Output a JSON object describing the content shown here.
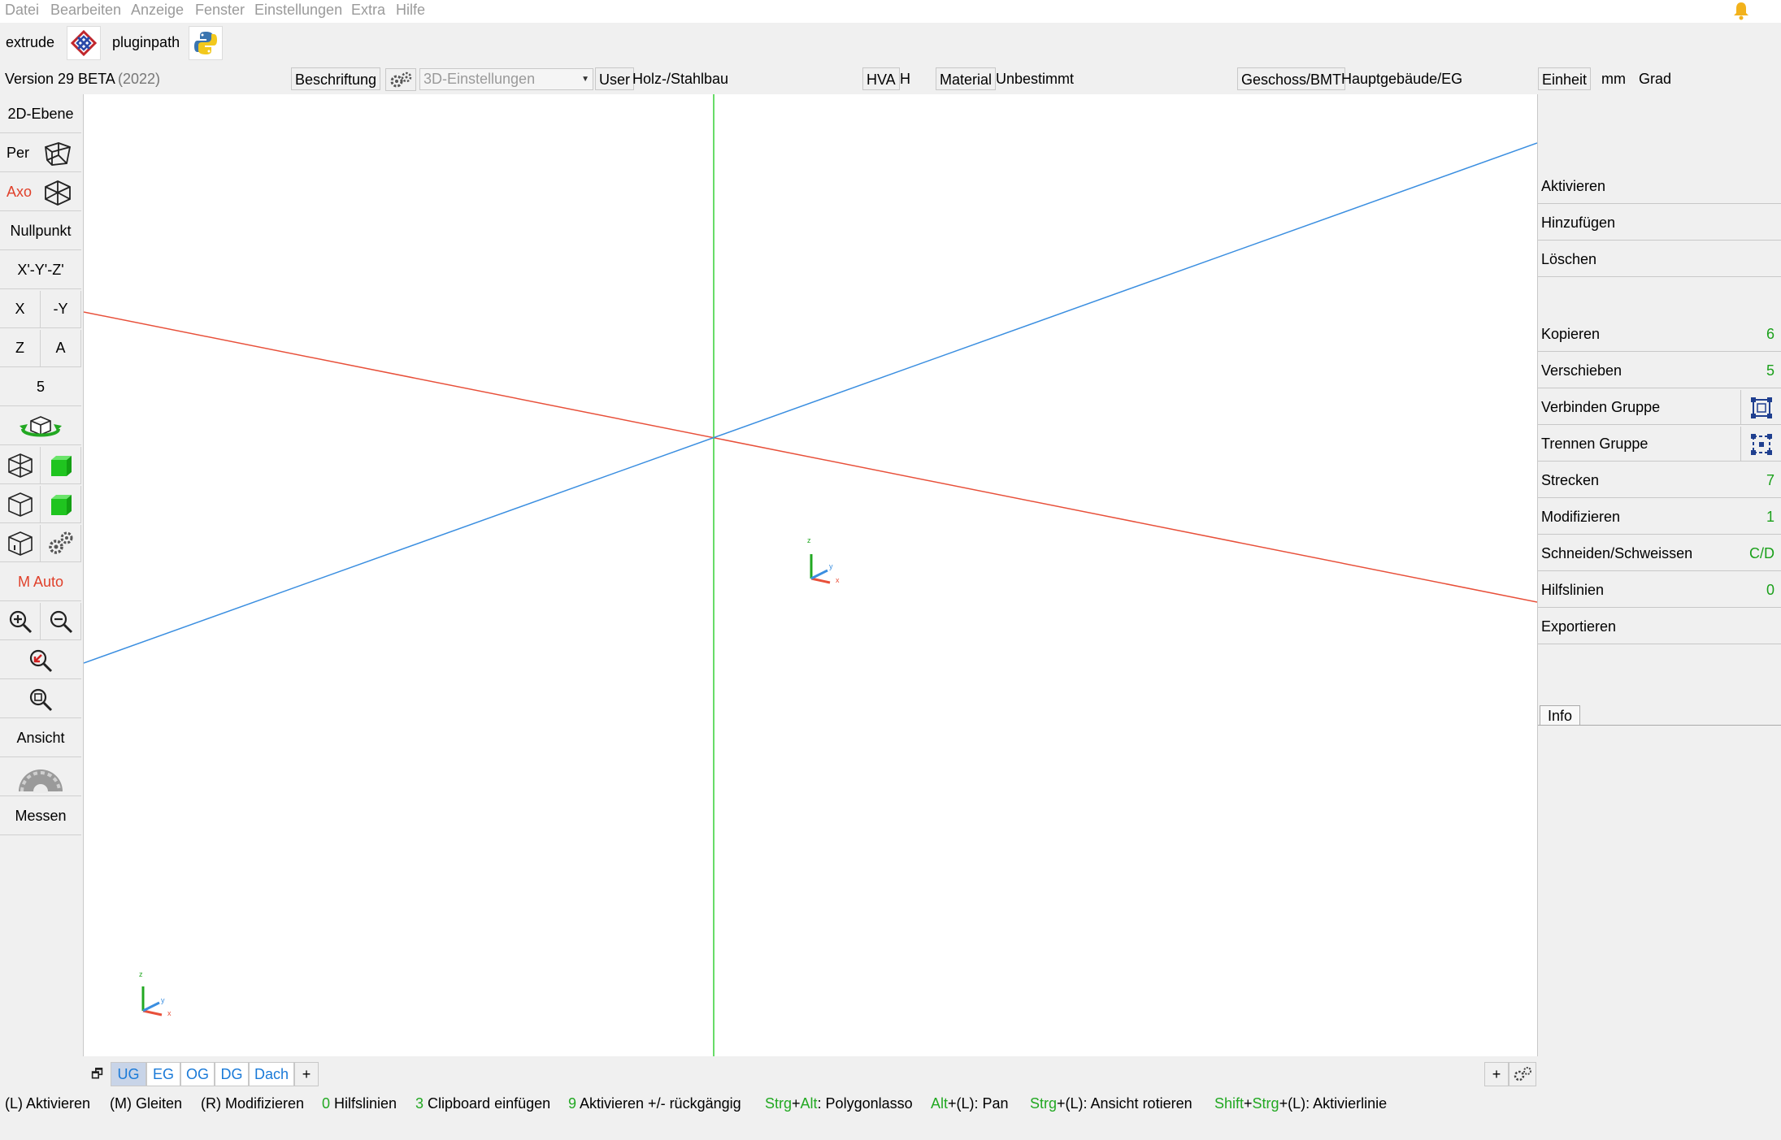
{
  "menu": [
    "Datei",
    "Bearbeiten",
    "Anzeige",
    "Fenster",
    "Einstellungen",
    "Extra",
    "Hilfe"
  ],
  "plugins": {
    "extrude_label": "extrude",
    "pluginpath_label": "pluginpath"
  },
  "infobar": {
    "version": "Version 29 BETA",
    "year": "(2022)",
    "beschriftung": "Beschriftung",
    "settings_select": "3D-Einstellungen",
    "user_btn": "User",
    "user_value": "Holz-/Stahlbau",
    "hva_btn": "HVA",
    "hva_value": "H",
    "material_btn": "Material",
    "material_value": "Unbestimmt",
    "geschoss_btn": "Geschoss/BMT",
    "geschoss_value": "Hauptgebäude/EG",
    "einheit_btn": "Einheit",
    "unit_length": "mm",
    "unit_angle": "Grad"
  },
  "left": {
    "ebene": "2D-Ebene",
    "per": "Per",
    "axo": "Axo",
    "nullpunkt": "Nullpunkt",
    "xyz": "X'-Y'-Z'",
    "x": "X",
    "neg_y": "-Y",
    "z": "Z",
    "a": "A",
    "five": "5",
    "mauto": "M Auto",
    "ansicht": "Ansicht",
    "messen": "Messen"
  },
  "right": {
    "aktivieren": "Aktivieren",
    "hinzufuegen": "Hinzufügen",
    "loeschen": "Löschen",
    "kopieren": "Kopieren",
    "kopieren_n": "6",
    "verschieben": "Verschieben",
    "verschieben_n": "5",
    "verbinden": "Verbinden Gruppe",
    "trennen": "Trennen Gruppe",
    "strecken": "Strecken",
    "strecken_n": "7",
    "modifizieren": "Modifizieren",
    "modifizieren_n": "1",
    "schneiden": "Schneiden/Schweissen",
    "schneiden_n": "C/D",
    "hilfslinien": "Hilfslinien",
    "hilfslinien_n": "0",
    "exportieren": "Exportieren",
    "info_tab": "Info"
  },
  "floors": [
    "UG",
    "EG",
    "OG",
    "DG",
    "Dach",
    "+"
  ],
  "floor_add": "+",
  "axis_labels": {
    "z": "z",
    "y": "y",
    "x": "x"
  },
  "status": {
    "s1": "(L) Aktivieren",
    "s2": "(M) Gleiten",
    "s3": "(R) Modifizieren",
    "s4_key": "0",
    "s4": " Hilfslinien",
    "s5_key": "3",
    "s5": " Clipboard einfügen",
    "s6_key": "9",
    "s6": " Aktivieren +/- rückgängig",
    "s7_k1": "Strg",
    "s7_k2": "+",
    "s7_k3": "Alt",
    "s7": ": Polygonlasso",
    "s8_key": "Alt",
    "s8": "+(L): Pan",
    "s9_key": "Strg",
    "s9": "+(L): Ansicht rotieren",
    "s10_k1": "Shift",
    "s10_k2": "+",
    "s10_k3": "Strg",
    "s10": "+(L): Aktivierlinie"
  },
  "colors": {
    "axis_x": "#e8503a",
    "axis_y": "#3a8ee0",
    "axis_z": "#36d036",
    "accent_green": "#1aa01a",
    "tab_blue": "#1a7ad8"
  }
}
